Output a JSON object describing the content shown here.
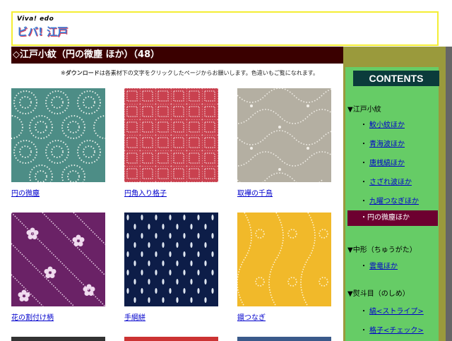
{
  "header": {
    "logo_line1": "Viva! edo",
    "logo_line2": "ビバ! 江戸"
  },
  "title": "◇江戸小紋（円の微塵 ほか）（48）",
  "notice_prefix": "※",
  "notice_bold": "ダウンロード",
  "notice_rest": "は各素材下の文字をクリックしたページからお願いします。色違いもご覧になれます。",
  "tiles": [
    {
      "label": "円の微塵",
      "color": "#4d8d86",
      "pattern": "circles"
    },
    {
      "label": "円角入り格子",
      "color": "#c9414f",
      "pattern": "grid"
    },
    {
      "label": "取襷の千鳥",
      "color": "#b4afa2",
      "pattern": "waves"
    },
    {
      "label": "花の割付け柄",
      "color": "#6a2266",
      "pattern": "flowers"
    },
    {
      "label": "手綱絣",
      "color": "#0d1d48",
      "pattern": "dashes"
    },
    {
      "label": "鐶つなぎ",
      "color": "#f1b92a",
      "pattern": "rings"
    }
  ],
  "sidebar": {
    "heading": "CONTENTS",
    "sections": [
      {
        "title": "▼江戸小紋",
        "items": [
          "鮫小紋ほか",
          "青海波ほか",
          "唐桟縞ほか",
          "さざれ波ほか",
          "九曜つなぎほか"
        ]
      },
      {
        "title": "▼中形（ちゅうがた）",
        "items": [
          "雲竜ほか"
        ]
      },
      {
        "title": "▼熨斗目（のしめ）",
        "items": [
          "縞<ストライプ>",
          "格子<チェック>"
        ]
      }
    ],
    "active_item": "・円の微塵ほか",
    "bullet": "・"
  }
}
